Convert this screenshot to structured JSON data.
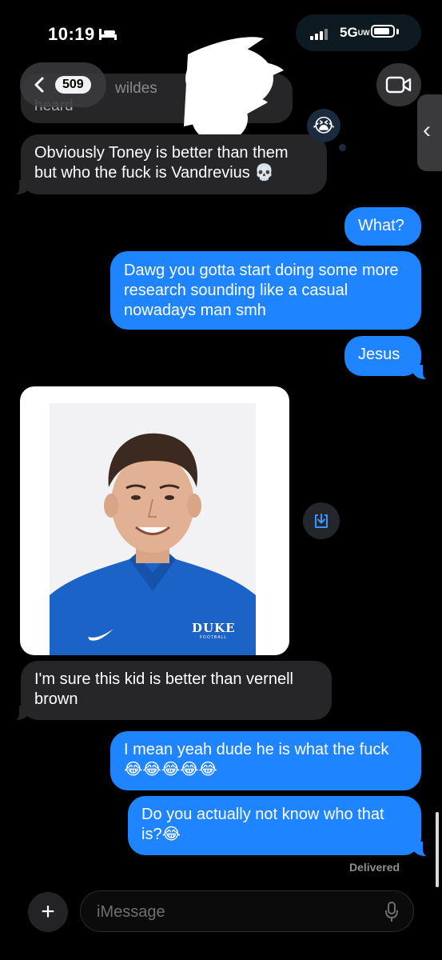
{
  "status_bar": {
    "time": "10:19",
    "network": "5GUW",
    "network_main": "5G",
    "network_sub": "UW",
    "battery_level": 0.85
  },
  "header": {
    "unread_count": "509",
    "partial_name_text": "wildes",
    "partial_prev_text": "heard"
  },
  "messages": [
    {
      "id": "m1",
      "direction": "received",
      "text": "Obviously Toney is better than them but who the fuck is Vandrevius 💀"
    },
    {
      "id": "m2",
      "direction": "sent",
      "text": "What?"
    },
    {
      "id": "m3",
      "direction": "sent",
      "text": "Dawg you gotta start doing some more research sounding like a casual nowadays man smh"
    },
    {
      "id": "m4",
      "direction": "sent",
      "text": "Jesus"
    },
    {
      "id": "m5",
      "direction": "received",
      "type": "image",
      "jersey_text": "DUKE",
      "jersey_sub": "FOOTBALL"
    },
    {
      "id": "m6",
      "direction": "received",
      "text": "I'm sure this kid is better than vernell brown"
    },
    {
      "id": "m7",
      "direction": "sent",
      "text": "I mean yeah dude he is what the fuck 😂😂😂😂😂"
    },
    {
      "id": "m8",
      "direction": "sent",
      "text": "Do you actually not know who that is?😂"
    }
  ],
  "reaction_emoji": "😭",
  "delivery_status": "Delivered",
  "composer": {
    "placeholder": "iMessage",
    "add_label": "+"
  },
  "colors": {
    "sent_bubble": "#1f84ff",
    "received_bubble": "#262628",
    "background": "#000000"
  }
}
